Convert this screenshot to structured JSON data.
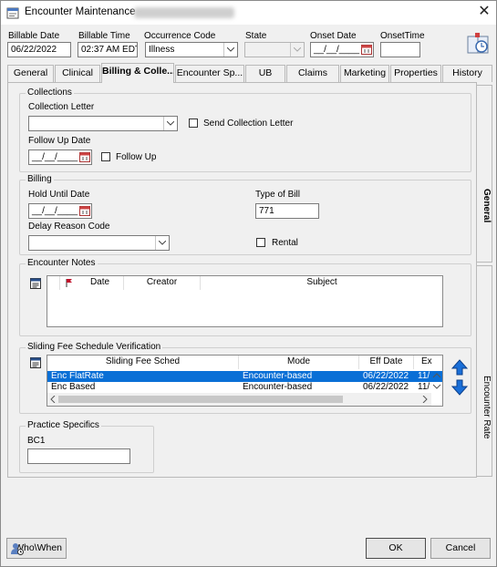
{
  "window": {
    "title": "Encounter Maintenance -",
    "close_glyph": "✕"
  },
  "header": {
    "billable_date": {
      "label": "Billable Date",
      "value": "06/22/2022"
    },
    "billable_time": {
      "label": "Billable Time",
      "value": "02:37 AM EDT"
    },
    "occurrence_code": {
      "label": "Occurrence Code",
      "value": "Illness"
    },
    "state": {
      "label": "State",
      "value": ""
    },
    "onset_date": {
      "label": "Onset Date",
      "value": "__/__/____"
    },
    "onset_time": {
      "label": "OnsetTime",
      "value": ""
    }
  },
  "tabs": [
    {
      "label": "General"
    },
    {
      "label": "Clinical"
    },
    {
      "label": "Billing & Colle..."
    },
    {
      "label": "Encounter  Sp..."
    },
    {
      "label": "UB"
    },
    {
      "label": "Claims"
    },
    {
      "label": "Marketing"
    },
    {
      "label": "Properties"
    },
    {
      "label": "History"
    }
  ],
  "vertical_tabs": {
    "general": "General",
    "encounter_rate": "Encounter Rate"
  },
  "collections": {
    "group_title": "Collections",
    "collection_letter_label": "Collection Letter",
    "collection_letter_value": "",
    "send_collection_letter_label": "Send Collection Letter",
    "follow_up_date_label": "Follow Up Date",
    "follow_up_date_value": "__/__/____",
    "follow_up_label": "Follow Up"
  },
  "billing": {
    "group_title": "Billing",
    "hold_until_date_label": "Hold Until Date",
    "hold_until_date_value": "__/__/____",
    "type_of_bill_label": "Type of Bill",
    "type_of_bill_value": "771",
    "delay_reason_code_label": "Delay Reason Code",
    "delay_reason_code_value": "",
    "rental_label": "Rental"
  },
  "encounter_notes": {
    "group_title": "Encounter Notes",
    "columns": [
      "Date",
      "Creator",
      "Subject"
    ]
  },
  "sliding_fee": {
    "group_title": "Sliding Fee Schedule Verification",
    "columns": [
      "Sliding Fee Sched",
      "Mode",
      "Eff Date",
      "Ex"
    ],
    "rows": [
      {
        "sched": "Enc FlatRate",
        "mode": "Encounter-based",
        "eff_date": "06/22/2022",
        "ex": "11/",
        "selected": true
      },
      {
        "sched": "Enc Based",
        "mode": "Encounter-based",
        "eff_date": "06/22/2022",
        "ex": "11/",
        "selected": false
      }
    ]
  },
  "practice_specifics": {
    "group_title": "Practice Specifics",
    "bc1_label": "BC1",
    "bc1_value": ""
  },
  "footer": {
    "who_when_label": "Who\\When",
    "ok_label": "OK",
    "cancel_label": "Cancel"
  },
  "colors": {
    "selection": "#0a6fd6",
    "arrow_blue": "#1a6fd8"
  }
}
